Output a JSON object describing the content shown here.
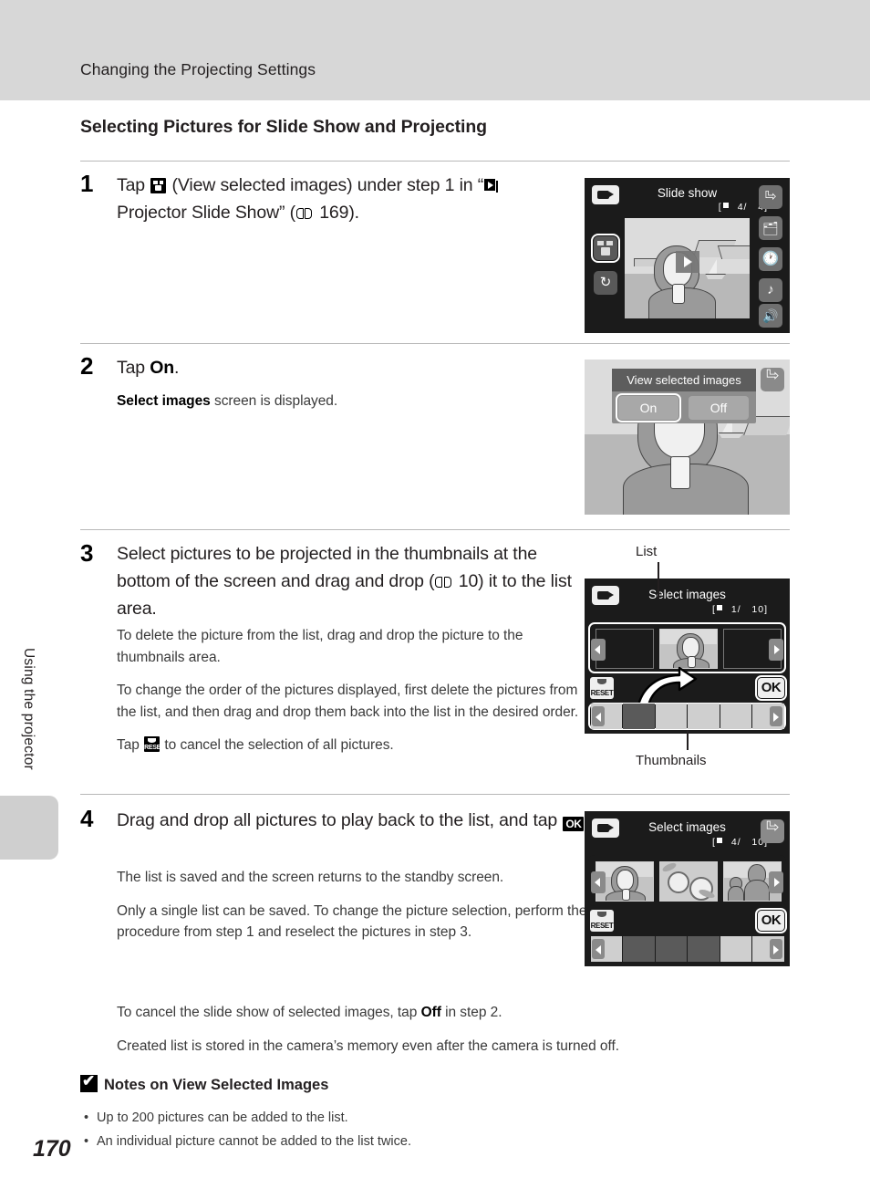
{
  "header": {
    "running_title": "Changing the Projecting Settings"
  },
  "side": {
    "chapter_label": "Using the projector",
    "page_number": "170"
  },
  "section": {
    "title": "Selecting Pictures for Slide Show and Projecting"
  },
  "steps": [
    {
      "number": "1",
      "head_pre": "Tap ",
      "head_mid": " (View selected images) under step 1 in “",
      "head_post": " Projector Slide Show” (",
      "ref_page": " 169).",
      "body": []
    },
    {
      "number": "2",
      "head_pre": "Tap ",
      "head_bold": "On",
      "head_post": ".",
      "body": [
        {
          "bold": "Select images",
          "rest": " screen is displayed."
        }
      ]
    },
    {
      "number": "3",
      "head": "Select pictures to be projected in the thumbnails at the bottom of the screen and drag and drop (",
      "head_ref": " 10) it to the list area.",
      "body": [
        "To delete the picture from the list, drag and drop the picture to the thumbnails area.",
        "To change the order of the pictures displayed, first delete the pictures from the list, and then drag and drop them back into the list in the desired order."
      ],
      "body_last_pre": "Tap ",
      "body_last_post": " to cancel the selection of all pictures."
    },
    {
      "number": "4",
      "head_pre": "Drag and drop all pictures to play back to the list, and tap ",
      "head_post": ".",
      "body": [
        "The list is saved and the screen returns to the standby screen.",
        "Only a single list can be saved. To change the picture selection, perform the procedure from step 1 and reselect the pictures in step 3."
      ],
      "body_off_pre": "To cancel the slide show of selected images, tap ",
      "body_off_bold": "Off",
      "body_off_post": " in step 2.",
      "body_stored": "Created list is stored in the camera’s memory even after the camera is turned off."
    }
  ],
  "notes": {
    "heading": "Notes on View Selected Images",
    "items": [
      "Up to 200 pictures can be added to the list.",
      "An individual picture cannot be added to the list twice."
    ]
  },
  "callouts": {
    "list": "List",
    "thumbnails": "Thumbnails"
  },
  "screens": {
    "screen1": {
      "title": "Slide show",
      "counter": "4/",
      "counter_total": "4]",
      "counter_open": "[",
      "left_icons": [
        "view-selected-images-icon",
        "loop-icon"
      ],
      "right_icons": [
        "back-icon",
        "copy-icon",
        "clock-icon",
        "music-icon",
        "volume-icon"
      ],
      "badge": "projector-icon"
    },
    "screen2": {
      "dialog_title": "View selected images",
      "option_on": "On",
      "option_off": "Off",
      "selected": "On",
      "back_icon": "back-icon"
    },
    "screen3": {
      "title": "Select images",
      "counter_open": "[",
      "counter": "1/",
      "counter_total": "10]",
      "ok_label": "OK",
      "reset_label": "RESET",
      "badge": "projector-icon",
      "back_icon": "back-icon"
    },
    "screen4": {
      "title": "Select images",
      "counter_open": "[",
      "counter": "4/",
      "counter_total": "10]",
      "ok_label": "OK",
      "reset_label": "RESET",
      "badge": "projector-icon",
      "back_icon": "back-icon"
    }
  },
  "colors": {
    "header_band": "#d7d7d7",
    "screen_bg": "#1b1b1b",
    "rule": "#b8b8b8",
    "body_text": "#3a3a3a"
  }
}
